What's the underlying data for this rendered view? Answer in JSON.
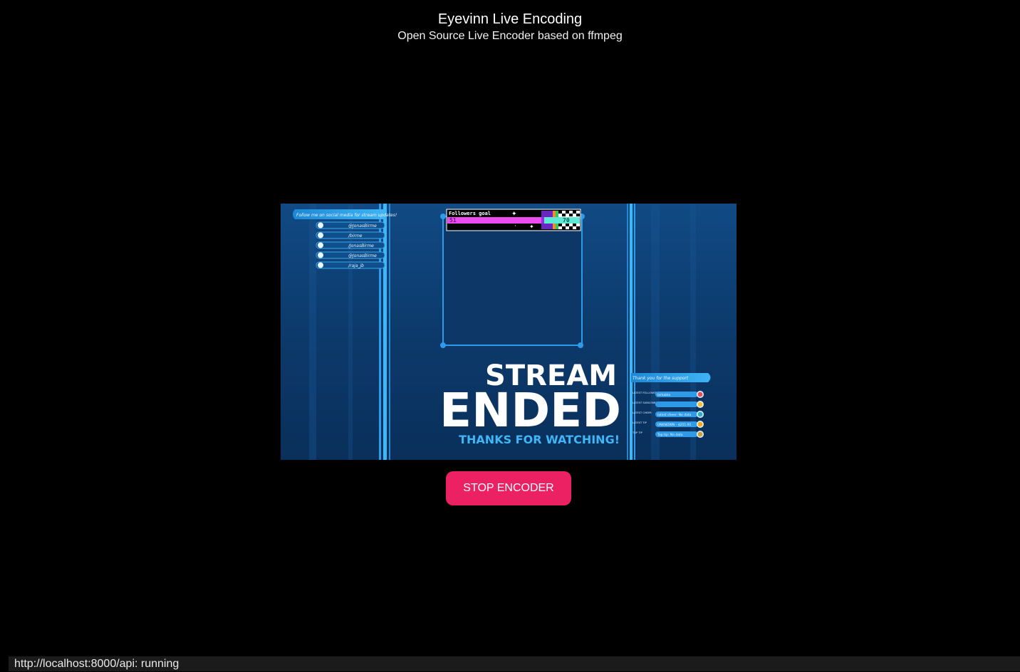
{
  "header": {
    "title": "Eyevinn Live Encoding",
    "subtitle": "Open Source Live Encoder based on ffmpeg"
  },
  "video": {
    "stream_line1": "STREAM",
    "stream_line2": "ENDED",
    "stream_line3": "THANKS FOR WATCHING!",
    "social_header": "Follow me on social media for stream updates!",
    "social_handles": [
      "@JonasBirme",
      "/birme",
      "/JonasBirme",
      "@JonasBirme",
      "/raja_jb"
    ],
    "goal_label": "Followers goal",
    "goal_current": "51",
    "goal_target": "70",
    "support_header": "Thank you for the support",
    "support_labels": [
      "LATEST FOLLOWER",
      "LATEST SUBSCRIBER",
      "LATEST CHEER",
      "LATEST TIP",
      "TOP TIP"
    ],
    "support_values": [
      "birkabla",
      "",
      "latest cheer: No data",
      "UNKNOWN - $251.91",
      "Top tip: No data"
    ]
  },
  "controls": {
    "stop_label": "STOP ENCODER"
  },
  "status": {
    "text": "http://localhost:8000/api: running"
  },
  "colors": {
    "button": "#ec2163",
    "accent": "#3aa8f0"
  }
}
